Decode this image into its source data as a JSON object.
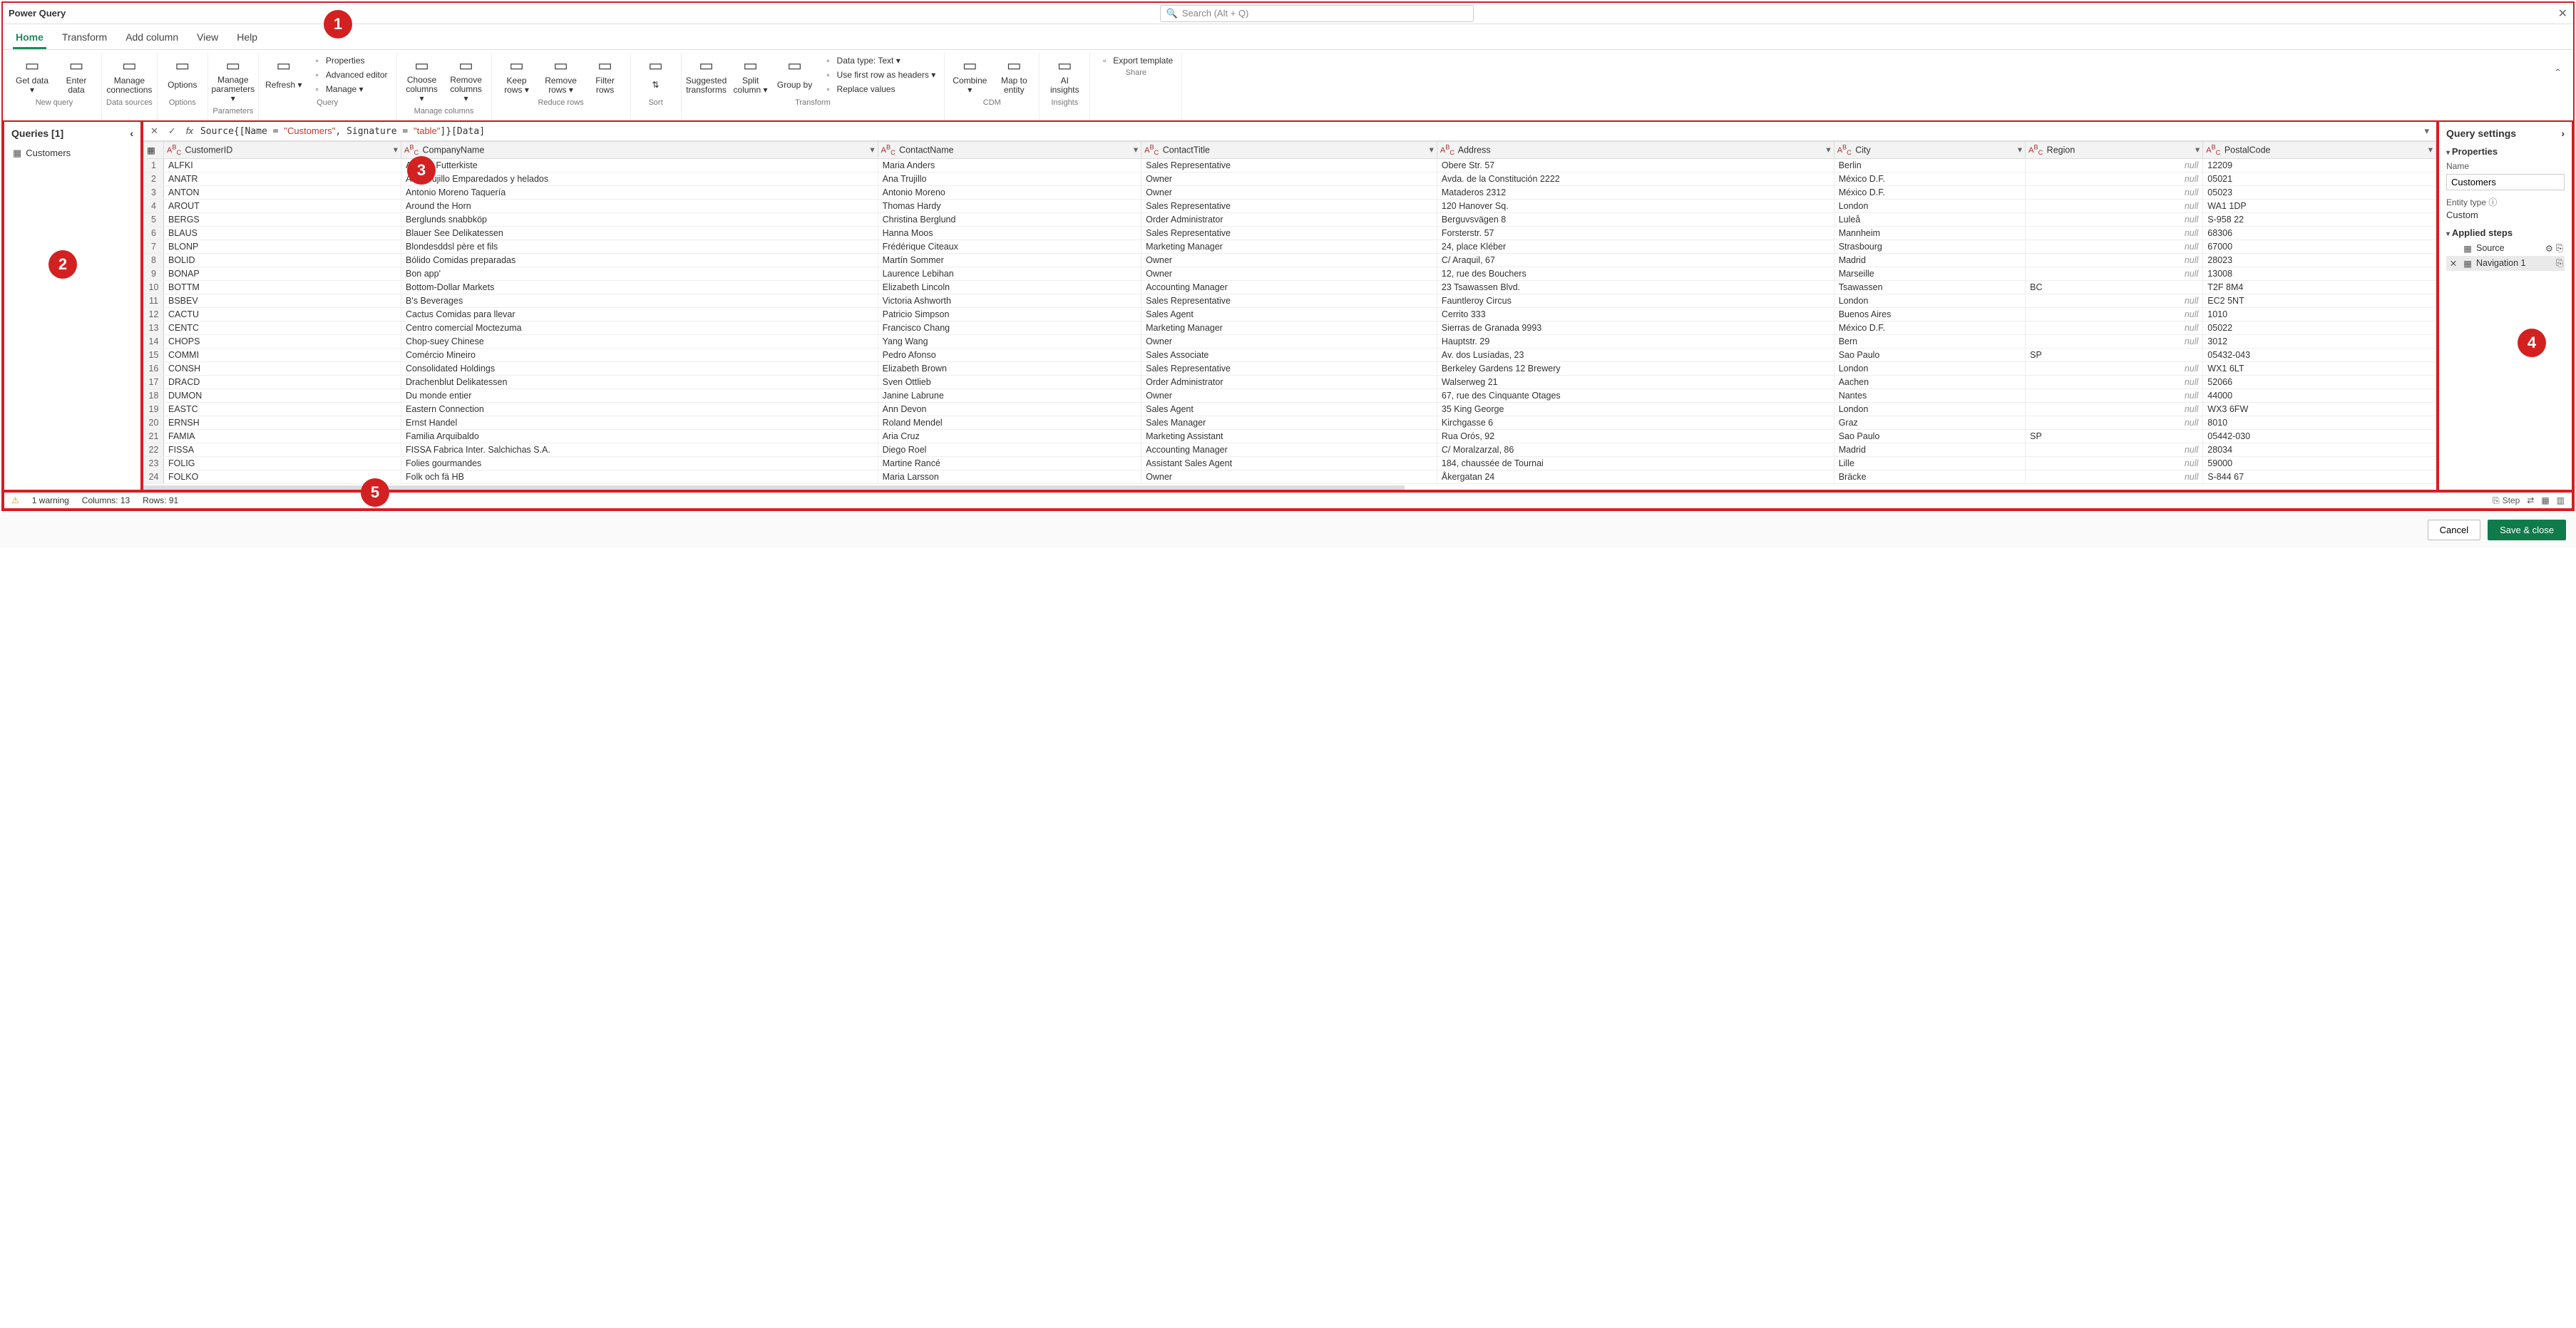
{
  "title": "Power Query",
  "search_placeholder": "Search (Alt + Q)",
  "tabs": [
    "Home",
    "Transform",
    "Add column",
    "View",
    "Help"
  ],
  "active_tab": 0,
  "ribbon": {
    "groups": [
      {
        "label": "New query",
        "items_lg": [
          {
            "label": "Get data ▾"
          },
          {
            "label": "Enter data"
          }
        ]
      },
      {
        "label": "Data sources",
        "items_lg": [
          {
            "label": "Manage connections"
          }
        ]
      },
      {
        "label": "Options",
        "items_lg": [
          {
            "label": "Options"
          }
        ]
      },
      {
        "label": "Parameters",
        "items_lg": [
          {
            "label": "Manage parameters ▾"
          }
        ]
      },
      {
        "label": "Query",
        "items_lg": [
          {
            "label": "Refresh ▾"
          }
        ],
        "items_sm": [
          {
            "label": "Properties"
          },
          {
            "label": "Advanced editor"
          },
          {
            "label": "Manage ▾"
          }
        ]
      },
      {
        "label": "Manage columns",
        "items_lg": [
          {
            "label": "Choose columns ▾"
          },
          {
            "label": "Remove columns ▾"
          }
        ]
      },
      {
        "label": "Reduce rows",
        "items_lg": [
          {
            "label": "Keep rows ▾"
          },
          {
            "label": "Remove rows ▾"
          },
          {
            "label": "Filter rows"
          }
        ]
      },
      {
        "label": "Sort",
        "items_lg": [
          {
            "label": "⇅"
          }
        ]
      },
      {
        "label": "Transform",
        "items_lg": [
          {
            "label": "Suggested transforms"
          },
          {
            "label": "Split column ▾"
          },
          {
            "label": "Group by"
          }
        ],
        "items_sm": [
          {
            "label": "Data type: Text ▾"
          },
          {
            "label": "Use first row as headers ▾"
          },
          {
            "label": "Replace values"
          }
        ]
      },
      {
        "label": "CDM",
        "items_lg": [
          {
            "label": "Combine ▾"
          },
          {
            "label": "Map to entity"
          }
        ]
      },
      {
        "label": "Insights",
        "items_lg": [
          {
            "label": "AI insights"
          }
        ]
      },
      {
        "label": "Share",
        "items_sm": [
          {
            "label": "Export template"
          }
        ]
      }
    ]
  },
  "queries_title": "Queries [1]",
  "queries": [
    {
      "name": "Customers"
    }
  ],
  "formula_text_parts": [
    "Source{[Name = ",
    "\"Customers\"",
    ", Signature = ",
    "\"table\"",
    "]}[Data]"
  ],
  "columns": [
    "CustomerID",
    "CompanyName",
    "ContactName",
    "ContactTitle",
    "Address",
    "City",
    "Region",
    "PostalCode"
  ],
  "rows": [
    [
      "ALFKI",
      "Alfreds Futterkiste",
      "Maria Anders",
      "Sales Representative",
      "Obere Str. 57",
      "Berlin",
      null,
      "12209"
    ],
    [
      "ANATR",
      "Ana Trujillo Emparedados y helados",
      "Ana Trujillo",
      "Owner",
      "Avda. de la Constitución 2222",
      "México D.F.",
      null,
      "05021"
    ],
    [
      "ANTON",
      "Antonio Moreno Taquería",
      "Antonio Moreno",
      "Owner",
      "Mataderos  2312",
      "México D.F.",
      null,
      "05023"
    ],
    [
      "AROUT",
      "Around the Horn",
      "Thomas Hardy",
      "Sales Representative",
      "120 Hanover Sq.",
      "London",
      null,
      "WA1 1DP"
    ],
    [
      "BERGS",
      "Berglunds snabbköp",
      "Christina Berglund",
      "Order Administrator",
      "Berguvsvägen  8",
      "Luleå",
      null,
      "S-958 22"
    ],
    [
      "BLAUS",
      "Blauer See Delikatessen",
      "Hanna Moos",
      "Sales Representative",
      "Forsterstr. 57",
      "Mannheim",
      null,
      "68306"
    ],
    [
      "BLONP",
      "Blondesddsl père et fils",
      "Frédérique Citeaux",
      "Marketing Manager",
      "24, place Kléber",
      "Strasbourg",
      null,
      "67000"
    ],
    [
      "BOLID",
      "Bólido Comidas preparadas",
      "Martín Sommer",
      "Owner",
      "C/ Araquil, 67",
      "Madrid",
      null,
      "28023"
    ],
    [
      "BONAP",
      "Bon app'",
      "Laurence Lebihan",
      "Owner",
      "12, rue des Bouchers",
      "Marseille",
      null,
      "13008"
    ],
    [
      "BOTTM",
      "Bottom-Dollar Markets",
      "Elizabeth Lincoln",
      "Accounting Manager",
      "23 Tsawassen Blvd.",
      "Tsawassen",
      "BC",
      "T2F 8M4"
    ],
    [
      "BSBEV",
      "B's Beverages",
      "Victoria Ashworth",
      "Sales Representative",
      "Fauntleroy Circus",
      "London",
      null,
      "EC2 5NT"
    ],
    [
      "CACTU",
      "Cactus Comidas para llevar",
      "Patricio Simpson",
      "Sales Agent",
      "Cerrito 333",
      "Buenos Aires",
      null,
      "1010"
    ],
    [
      "CENTC",
      "Centro comercial Moctezuma",
      "Francisco Chang",
      "Marketing Manager",
      "Sierras de Granada 9993",
      "México D.F.",
      null,
      "05022"
    ],
    [
      "CHOPS",
      "Chop-suey Chinese",
      "Yang Wang",
      "Owner",
      "Hauptstr. 29",
      "Bern",
      null,
      "3012"
    ],
    [
      "COMMI",
      "Comércio Mineiro",
      "Pedro Afonso",
      "Sales Associate",
      "Av. dos Lusíadas, 23",
      "Sao Paulo",
      "SP",
      "05432-043"
    ],
    [
      "CONSH",
      "Consolidated Holdings",
      "Elizabeth Brown",
      "Sales Representative",
      "Berkeley Gardens 12  Brewery",
      "London",
      null,
      "WX1 6LT"
    ],
    [
      "DRACD",
      "Drachenblut Delikatessen",
      "Sven Ottlieb",
      "Order Administrator",
      "Walserweg 21",
      "Aachen",
      null,
      "52066"
    ],
    [
      "DUMON",
      "Du monde entier",
      "Janine Labrune",
      "Owner",
      "67, rue des Cinquante Otages",
      "Nantes",
      null,
      "44000"
    ],
    [
      "EASTC",
      "Eastern Connection",
      "Ann Devon",
      "Sales Agent",
      "35 King George",
      "London",
      null,
      "WX3 6FW"
    ],
    [
      "ERNSH",
      "Ernst Handel",
      "Roland Mendel",
      "Sales Manager",
      "Kirchgasse 6",
      "Graz",
      null,
      "8010"
    ],
    [
      "FAMIA",
      "Familia Arquibaldo",
      "Aria Cruz",
      "Marketing Assistant",
      "Rua Orós, 92",
      "Sao Paulo",
      "SP",
      "05442-030"
    ],
    [
      "FISSA",
      "FISSA Fabrica Inter. Salchichas S.A.",
      "Diego Roel",
      "Accounting Manager",
      "C/ Moralzarzal, 86",
      "Madrid",
      null,
      "28034"
    ],
    [
      "FOLIG",
      "Folies gourmandes",
      "Martine Rancé",
      "Assistant Sales Agent",
      "184, chaussée de Tournai",
      "Lille",
      null,
      "59000"
    ],
    [
      "FOLKO",
      "Folk och fä HB",
      "Maria Larsson",
      "Owner",
      "Åkergatan 24",
      "Bräcke",
      null,
      "S-844 67"
    ]
  ],
  "null_text": "null",
  "settings": {
    "title": "Query settings",
    "properties_label": "Properties",
    "name_label": "Name",
    "name_value": "Customers",
    "entity_label": "Entity type ⓘ",
    "entity_value": "Custom",
    "steps_label": "Applied steps",
    "steps": [
      {
        "name": "Source",
        "has_gear": true,
        "icon": "table-icon"
      },
      {
        "name": "Navigation 1",
        "has_gear": false,
        "icon": "table-icon",
        "selected": true,
        "deletable": true
      }
    ]
  },
  "status": {
    "warning": "1 warning",
    "columns": "Columns: 13",
    "rows": "Rows: 91",
    "step_label": "Step"
  },
  "footer": {
    "cancel": "Cancel",
    "save": "Save & close"
  },
  "callouts": {
    "c1": "1",
    "c2": "2",
    "c3": "3",
    "c4": "4",
    "c5": "5"
  }
}
